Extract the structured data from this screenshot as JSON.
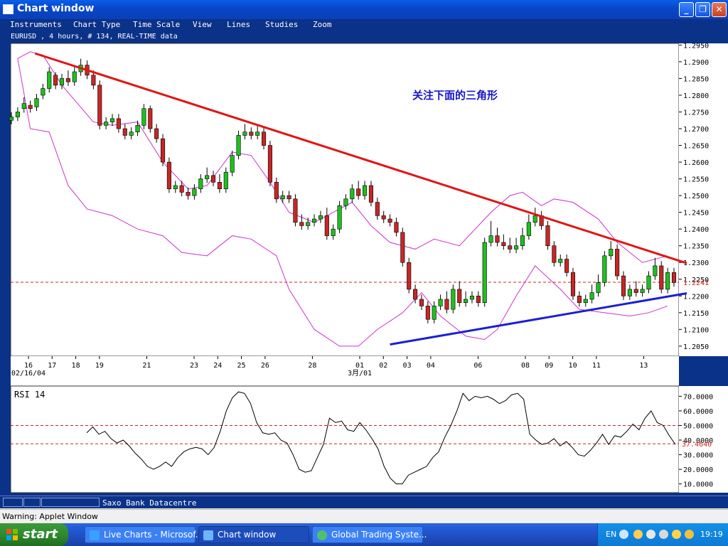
{
  "window": {
    "title": "Chart window"
  },
  "menu": [
    "Instruments",
    "Chart Type",
    "Time Scale",
    "View",
    "Lines",
    "Studies",
    "Zoom"
  ],
  "instrument_label": "EURUSD , 4 hours, # 134, REAL-TIME data",
  "annotation": "关注下面的三角形",
  "status": {
    "provider": "Saxo Bank Datacentre"
  },
  "warning": "Warning: Applet Window",
  "taskbar": {
    "start": "start",
    "tasks": [
      {
        "label": "Live Charts - Microsof...",
        "active": false,
        "icon": "ie-icon"
      },
      {
        "label": "Chart window",
        "active": true,
        "icon": "java-icon"
      },
      {
        "label": "Global Trading Syste...",
        "active": false,
        "icon": "globe-icon"
      }
    ],
    "lang": "EN",
    "clock": "19:19"
  },
  "colors": {
    "background": "#0b3289",
    "bull_candle": "#1fbf1f",
    "bear_candle": "#c42727",
    "bollinger": "#cc33cc",
    "resistance_line": "#e01515",
    "support_line": "#1e1ed2",
    "current_price_line": "#cc2222",
    "annotation": "#1616c8"
  },
  "chart_data": [
    {
      "type": "candlestick",
      "panel": "price",
      "instrument": "EURUSD",
      "timeframe": "4 hours",
      "bars": 134,
      "ylim": [
        1.202,
        1.2955
      ],
      "ytick_labels": [
        "1.2950",
        "1.2900",
        "1.2850",
        "1.2800",
        "1.2750",
        "1.2700",
        "1.2650",
        "1.2600",
        "1.2550",
        "1.2500",
        "1.2450",
        "1.2400",
        "1.2350",
        "1.2300",
        "1.2250",
        "1.2200",
        "1.2150",
        "1.2100",
        "1.2050"
      ],
      "yticks": [
        1.295,
        1.29,
        1.285,
        1.28,
        1.275,
        1.27,
        1.265,
        1.26,
        1.255,
        1.25,
        1.245,
        1.24,
        1.235,
        1.23,
        1.225,
        1.22,
        1.215,
        1.21,
        1.205
      ],
      "current_price": 1.2241,
      "current_price_label": "1.2241",
      "xtick_labels": [
        "16",
        "17",
        "18",
        "19",
        "21",
        "23",
        "24",
        "25",
        "26",
        "28",
        "01",
        "02",
        "03",
        "04",
        "06",
        "08",
        "09",
        "10",
        "11",
        "13"
      ],
      "xtick_sublabels": [
        "02/16/04",
        "",
        "",
        "",
        "",
        "",
        "",
        "",
        "",
        "",
        "3月/01",
        "",
        "",
        "",
        "",
        "",
        "",
        "",
        "",
        ""
      ],
      "date_range": [
        "2004-02-16",
        "2004-03-15"
      ],
      "trendlines": [
        {
          "name": "resistance",
          "from": [
            "2004-02-17",
            1.2925
          ],
          "to": [
            "2004-03-15",
            1.2298
          ]
        },
        {
          "name": "support",
          "from": [
            "2004-03-03",
            1.2055
          ],
          "to": [
            "2004-03-15",
            1.2208
          ]
        }
      ],
      "candles_ohlc_approx": [
        [
          1.2725,
          1.2745,
          1.2735
        ],
        [
          1.2735,
          1.276,
          1.275
        ],
        [
          1.276,
          1.279,
          1.2775
        ],
        [
          1.277,
          1.278,
          1.276
        ],
        [
          1.2765,
          1.28,
          1.279
        ],
        [
          1.28,
          1.283,
          1.282
        ],
        [
          1.282,
          1.288,
          1.287
        ],
        [
          1.286,
          1.2865,
          1.283
        ],
        [
          1.283,
          1.286,
          1.285
        ],
        [
          1.285,
          1.287,
          1.284
        ],
        [
          1.284,
          1.288,
          1.287
        ],
        [
          1.287,
          1.2905,
          1.289
        ],
        [
          1.289,
          1.29,
          1.286
        ],
        [
          1.286,
          1.287,
          1.283
        ],
        [
          1.283,
          1.284,
          1.271
        ],
        [
          1.271,
          1.273,
          1.272
        ],
        [
          1.272,
          1.274,
          1.273
        ],
        [
          1.273,
          1.274,
          1.27
        ],
        [
          1.27,
          1.271,
          1.268
        ],
        [
          1.268,
          1.27,
          1.269
        ],
        [
          1.269,
          1.272,
          1.271
        ],
        [
          1.271,
          1.277,
          1.276
        ],
        [
          1.276,
          1.2765,
          1.27
        ],
        [
          1.27,
          1.271,
          1.267
        ],
        [
          1.267,
          1.268,
          1.26
        ],
        [
          1.26,
          1.261,
          1.252
        ],
        [
          1.252,
          1.254,
          1.253
        ],
        [
          1.253,
          1.254,
          1.251
        ],
        [
          1.251,
          1.252,
          1.25
        ],
        [
          1.25,
          1.253,
          1.252
        ],
        [
          1.252,
          1.256,
          1.255
        ],
        [
          1.255,
          1.258,
          1.256
        ],
        [
          1.256,
          1.257,
          1.254
        ],
        [
          1.254,
          1.256,
          1.252
        ],
        [
          1.252,
          1.258,
          1.257
        ],
        [
          1.257,
          1.263,
          1.262
        ],
        [
          1.262,
          1.269,
          1.268
        ],
        [
          1.268,
          1.271,
          1.269
        ],
        [
          1.269,
          1.27,
          1.268
        ],
        [
          1.268,
          1.271,
          1.269
        ],
        [
          1.269,
          1.27,
          1.265
        ],
        [
          1.265,
          1.266,
          1.254
        ],
        [
          1.254,
          1.255,
          1.249
        ],
        [
          1.249,
          1.251,
          1.25
        ],
        [
          1.25,
          1.251,
          1.249
        ],
        [
          1.249,
          1.25,
          1.242
        ],
        [
          1.242,
          1.244,
          1.241
        ],
        [
          1.241,
          1.243,
          1.242
        ],
        [
          1.242,
          1.244,
          1.243
        ],
        [
          1.243,
          1.245,
          1.244
        ],
        [
          1.244,
          1.246,
          1.238
        ],
        [
          1.238,
          1.241,
          1.24
        ],
        [
          1.24,
          1.248,
          1.247
        ],
        [
          1.247,
          1.25,
          1.249
        ],
        [
          1.249,
          1.253,
          1.252
        ],
        [
          1.252,
          1.254,
          1.25
        ],
        [
          1.25,
          1.254,
          1.253
        ],
        [
          1.253,
          1.254,
          1.248
        ],
        [
          1.248,
          1.249,
          1.244
        ],
        [
          1.244,
          1.245,
          1.243
        ],
        [
          1.243,
          1.244,
          1.242
        ],
        [
          1.242,
          1.243,
          1.239
        ],
        [
          1.239,
          1.24,
          1.23
        ],
        [
          1.23,
          1.231,
          1.222
        ],
        [
          1.222,
          1.223,
          1.219
        ],
        [
          1.219,
          1.22,
          1.217
        ],
        [
          1.217,
          1.218,
          1.213
        ],
        [
          1.213,
          1.218,
          1.217
        ],
        [
          1.217,
          1.22,
          1.219
        ],
        [
          1.219,
          1.221,
          1.216
        ],
        [
          1.216,
          1.223,
          1.222
        ],
        [
          1.222,
          1.224,
          1.218
        ],
        [
          1.218,
          1.221,
          1.219
        ],
        [
          1.219,
          1.221,
          1.22
        ],
        [
          1.22,
          1.221,
          1.218
        ],
        [
          1.218,
          1.237,
          1.236
        ],
        [
          1.236,
          1.242,
          1.238
        ],
        [
          1.238,
          1.24,
          1.236
        ],
        [
          1.236,
          1.238,
          1.235
        ],
        [
          1.235,
          1.237,
          1.234
        ],
        [
          1.234,
          1.237,
          1.235
        ],
        [
          1.235,
          1.24,
          1.238
        ],
        [
          1.238,
          1.244,
          1.242
        ],
        [
          1.242,
          1.246,
          1.244
        ],
        [
          1.244,
          1.245,
          1.241
        ],
        [
          1.241,
          1.242,
          1.235
        ],
        [
          1.235,
          1.236,
          1.23
        ],
        [
          1.23,
          1.232,
          1.231
        ],
        [
          1.231,
          1.232,
          1.227
        ],
        [
          1.227,
          1.228,
          1.22
        ],
        [
          1.22,
          1.221,
          1.218
        ],
        [
          1.218,
          1.22,
          1.219
        ],
        [
          1.219,
          1.223,
          1.221
        ],
        [
          1.221,
          1.226,
          1.224
        ],
        [
          1.224,
          1.233,
          1.232
        ],
        [
          1.232,
          1.236,
          1.234
        ],
        [
          1.234,
          1.235,
          1.226
        ],
        [
          1.226,
          1.227,
          1.22
        ],
        [
          1.22,
          1.223,
          1.222
        ],
        [
          1.222,
          1.224,
          1.221
        ],
        [
          1.221,
          1.223,
          1.222
        ],
        [
          1.222,
          1.227,
          1.226
        ],
        [
          1.226,
          1.231,
          1.229
        ],
        [
          1.229,
          1.23,
          1.222
        ],
        [
          1.222,
          1.228,
          1.227
        ],
        [
          1.227,
          1.228,
          1.224
        ]
      ],
      "bollinger_upper_approx": [
        [
          1,
          1.291
        ],
        [
          3,
          1.293
        ],
        [
          5,
          1.292
        ],
        [
          8,
          1.283
        ],
        [
          13,
          1.272
        ],
        [
          16,
          1.271
        ],
        [
          20,
          1.272
        ],
        [
          24,
          1.26
        ],
        [
          28,
          1.252
        ],
        [
          31,
          1.253
        ],
        [
          35,
          1.263
        ],
        [
          38,
          1.262
        ],
        [
          41,
          1.254
        ],
        [
          44,
          1.245
        ],
        [
          48,
          1.242
        ],
        [
          52,
          1.246
        ],
        [
          54,
          1.248
        ],
        [
          57,
          1.241
        ],
        [
          60,
          1.236
        ],
        [
          64,
          1.234
        ],
        [
          67,
          1.237
        ],
        [
          71,
          1.235
        ],
        [
          76,
          1.245
        ],
        [
          79,
          1.25
        ],
        [
          81,
          1.251
        ],
        [
          84,
          1.247
        ],
        [
          86,
          1.249
        ],
        [
          89,
          1.248
        ],
        [
          93,
          1.243
        ],
        [
          96,
          1.236
        ],
        [
          100,
          1.23
        ],
        [
          104,
          1.232
        ]
      ],
      "bollinger_lower_approx": [
        [
          1,
          1.291
        ],
        [
          3,
          1.27
        ],
        [
          6,
          1.269
        ],
        [
          9,
          1.253
        ],
        [
          12,
          1.246
        ],
        [
          16,
          1.244
        ],
        [
          20,
          1.24
        ],
        [
          24,
          1.238
        ],
        [
          27,
          1.233
        ],
        [
          31,
          1.232
        ],
        [
          35,
          1.238
        ],
        [
          38,
          1.237
        ],
        [
          42,
          1.232
        ],
        [
          44,
          1.222
        ],
        [
          48,
          1.21
        ],
        [
          52,
          1.205
        ],
        [
          55,
          1.205
        ],
        [
          58,
          1.21
        ],
        [
          62,
          1.215
        ],
        [
          65,
          1.221
        ],
        [
          68,
          1.214
        ],
        [
          72,
          1.208
        ],
        [
          75,
          1.207
        ],
        [
          77,
          1.21
        ],
        [
          80,
          1.22
        ],
        [
          83,
          1.229
        ],
        [
          87,
          1.222
        ],
        [
          90,
          1.216
        ],
        [
          94,
          1.215
        ],
        [
          98,
          1.214
        ],
        [
          101,
          1.215
        ],
        [
          104,
          1.217
        ]
      ]
    },
    {
      "type": "line",
      "panel": "indicator",
      "name": "RSI 14",
      "ylim": [
        4,
        77
      ],
      "ytick_labels": [
        "70.0000",
        "60.0000",
        "50.0000",
        "40.0000",
        "30.0000",
        "20.0000",
        "10.0000"
      ],
      "yticks": [
        70,
        60,
        50,
        40,
        30,
        20,
        10
      ],
      "levels": [
        50,
        37.464
      ],
      "current_label": "37.4640",
      "values_approx": [
        45,
        49,
        44,
        46,
        41,
        38,
        40,
        36,
        31,
        27,
        22,
        20,
        22,
        25,
        22,
        28,
        32,
        34,
        35,
        34,
        30,
        35,
        46,
        60,
        69,
        73,
        72,
        65,
        52,
        45,
        44,
        45,
        40,
        38,
        30,
        20,
        18,
        19,
        28,
        37,
        55,
        52,
        53,
        47,
        46,
        52,
        47,
        41,
        34,
        22,
        14,
        10,
        10,
        16,
        18,
        20,
        22,
        28,
        32,
        42,
        50,
        60,
        72,
        67,
        70,
        69,
        70,
        68,
        65,
        67,
        71,
        72,
        68,
        44,
        40,
        37,
        38,
        41,
        36,
        39,
        35,
        30,
        29,
        33,
        38,
        44,
        37,
        43,
        42,
        46,
        51,
        47,
        55,
        60,
        52,
        50,
        43,
        37
      ]
    }
  ]
}
